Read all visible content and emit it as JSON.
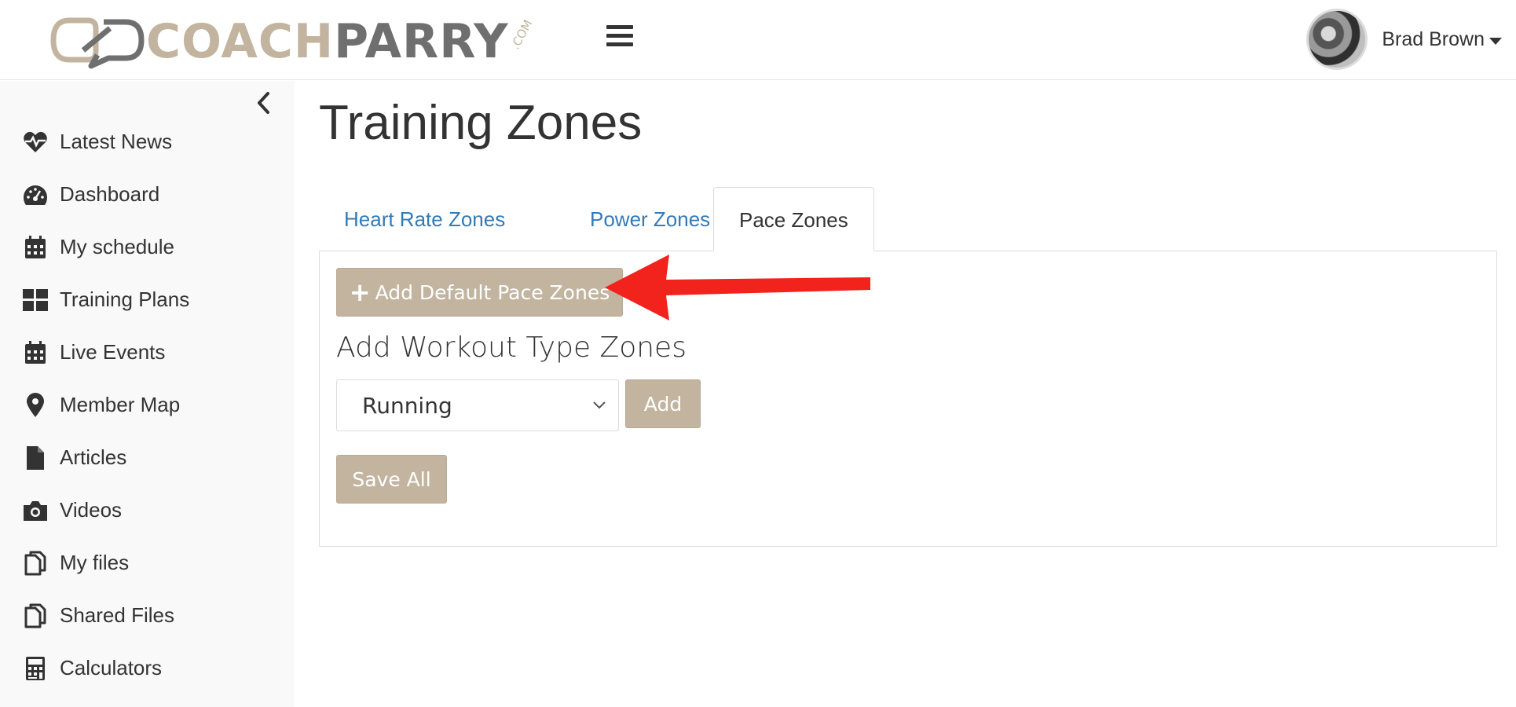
{
  "header": {
    "logo": {
      "part1": "COACH",
      "part2": "PARRY",
      "suffix": ".COM"
    },
    "user_name": "Brad Brown"
  },
  "sidebar": {
    "items": [
      {
        "label": "Latest News",
        "icon": "heartbeat-icon"
      },
      {
        "label": "Dashboard",
        "icon": "dashboard-gauge-icon"
      },
      {
        "label": "My schedule",
        "icon": "calendar-icon"
      },
      {
        "label": "Training Plans",
        "icon": "grid-icon"
      },
      {
        "label": "Live Events",
        "icon": "calendar-icon"
      },
      {
        "label": "Member Map",
        "icon": "map-marker-icon"
      },
      {
        "label": "Articles",
        "icon": "file-icon"
      },
      {
        "label": "Videos",
        "icon": "camera-icon"
      },
      {
        "label": "My files",
        "icon": "copy-files-icon"
      },
      {
        "label": "Shared Files",
        "icon": "copy-files-icon"
      },
      {
        "label": "Calculators",
        "icon": "calculator-icon"
      }
    ]
  },
  "main": {
    "title": "Training Zones",
    "tabs": [
      {
        "label": "Heart Rate Zones",
        "active": false
      },
      {
        "label": "Power Zones",
        "active": false
      },
      {
        "label": "Pace Zones",
        "active": true
      }
    ],
    "panel": {
      "add_default_label": "Add Default Pace Zones",
      "section_title": "Add Workout Type Zones",
      "workout_type_selected": "Running",
      "add_label": "Add",
      "save_all_label": "Save All"
    }
  },
  "colors": {
    "accent_tan": "#c2b49f",
    "link_blue": "#337ab7",
    "annotation_red": "#f2221c"
  }
}
